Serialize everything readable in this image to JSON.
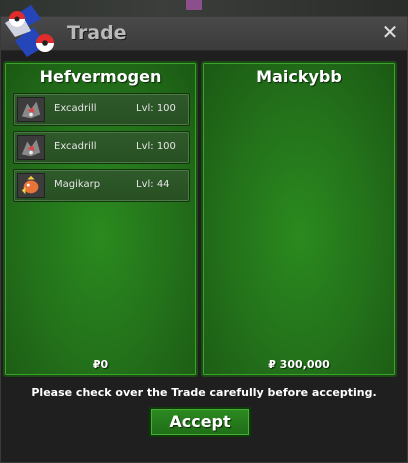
{
  "window": {
    "title": "Trade",
    "close_glyph": "✕"
  },
  "left_player": {
    "name": "Hefvermogen",
    "balance": "₽0",
    "offers": [
      {
        "pokemon": "Excadrill",
        "level": "Lvl: 100",
        "icon": "excadrill-icon"
      },
      {
        "pokemon": "Excadrill",
        "level": "Lvl: 100",
        "icon": "excadrill-icon"
      },
      {
        "pokemon": "Magikarp",
        "level": "Lvl: 44",
        "icon": "magikarp-icon"
      }
    ]
  },
  "right_player": {
    "name": "Maickybb",
    "balance": "₽ 300,000",
    "offers": []
  },
  "footer": {
    "notice": "Please check over the Trade carefully before accepting.",
    "accept_label": "Accept"
  },
  "colors": {
    "panel_green": "#23701a",
    "button_green": "#2c8a20",
    "titlebar": "#404040"
  }
}
